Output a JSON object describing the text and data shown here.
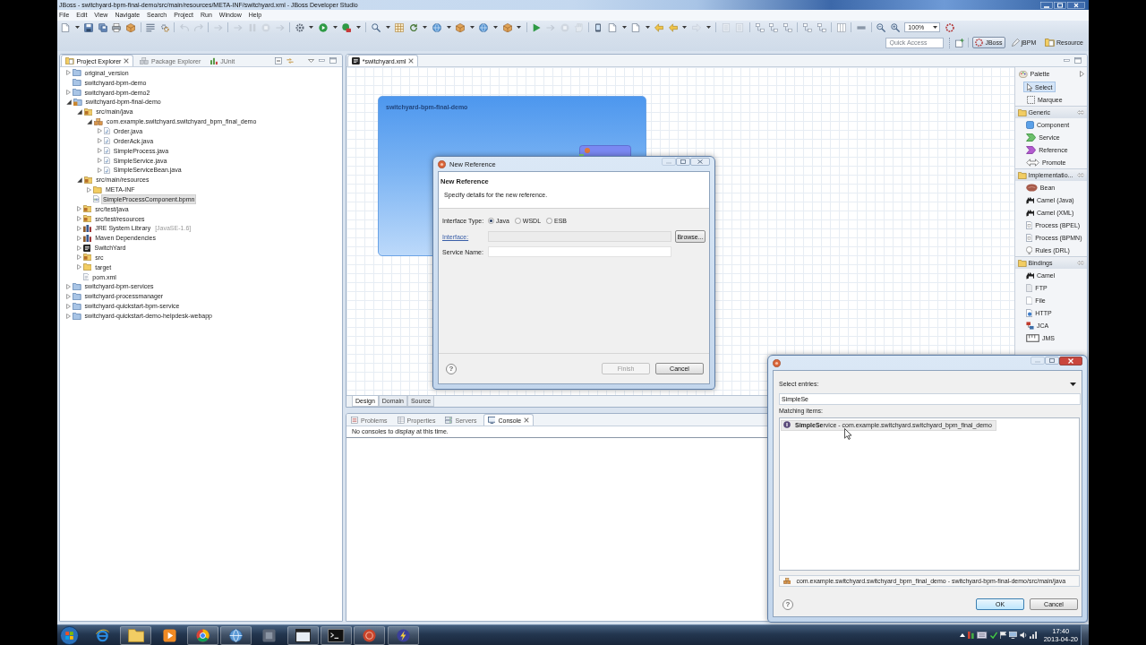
{
  "window": {
    "title": "JBoss - switchyard-bpm-final-demo/src/main/resources/META-INF/switchyard.xml - JBoss Developer Studio"
  },
  "menu": [
    "File",
    "Edit",
    "View",
    "Navigate",
    "Search",
    "Project",
    "Run",
    "Window",
    "Help"
  ],
  "toolbar": {
    "zoom": "100%"
  },
  "perspective_bar": {
    "quick_access": {
      "placeholder": "Quick Access"
    },
    "perspectives": [
      {
        "label": "JBoss",
        "kind": "jboss",
        "selected": true
      },
      {
        "label": "jBPM",
        "kind": "jbpm",
        "selected": false
      },
      {
        "label": "Resource",
        "kind": "resource",
        "selected": false
      }
    ]
  },
  "explorer": {
    "tabs": [
      {
        "label": "Project Explorer",
        "kind": "project",
        "selected": true
      },
      {
        "label": "Package Explorer",
        "kind": "package",
        "selected": false
      },
      {
        "label": "JUnit",
        "kind": "junit",
        "selected": false
      }
    ],
    "tree": [
      {
        "label": "original_version",
        "kind": "project",
        "expanded": false,
        "selected": false
      },
      {
        "label": "switchyard-bpm-demo",
        "kind": "project",
        "selected": false
      },
      {
        "label": "switchyard-bpm-demo2",
        "kind": "project",
        "expanded": false,
        "selected": false
      },
      {
        "label": "switchyard-bpm-final-demo",
        "kind": "java-project",
        "expanded": true,
        "selected": false,
        "children": [
          {
            "label": "src/main/java",
            "kind": "source-folder",
            "expanded": true,
            "selected": false,
            "children": [
              {
                "label": "com.example.switchyard.switchyard_bpm_final_demo",
                "kind": "package",
                "expanded": true,
                "selected": false,
                "children": [
                  {
                    "label": "Order.java",
                    "kind": "java-file",
                    "expanded": false,
                    "selected": false
                  },
                  {
                    "label": "OrderAck.java",
                    "kind": "java-file",
                    "expanded": false,
                    "selected": false
                  },
                  {
                    "label": "SimpleProcess.java",
                    "kind": "java-file",
                    "expanded": false,
                    "selected": false
                  },
                  {
                    "label": "SimpleService.java",
                    "kind": "java-file",
                    "expanded": false,
                    "selected": false
                  },
                  {
                    "label": "SimpleServiceBean.java",
                    "kind": "java-file",
                    "expanded": false,
                    "selected": false
                  }
                ]
              }
            ]
          },
          {
            "label": "src/main/resources",
            "kind": "source-folder",
            "expanded": true,
            "selected": false,
            "children": [
              {
                "label": "META-INF",
                "kind": "folder",
                "expanded": false,
                "selected": false
              },
              {
                "label": "SimpleProcessComponent.bpmn",
                "kind": "diagram-file",
                "selected": true
              }
            ]
          },
          {
            "label": "src/test/java",
            "kind": "source-folder",
            "expanded": false,
            "selected": false
          },
          {
            "label": "src/test/resources",
            "kind": "source-folder",
            "expanded": false,
            "selected": false
          },
          {
            "label": "JRE System Library",
            "decoration": "[JavaSE-1.6]",
            "kind": "library",
            "expanded": false,
            "selected": false
          },
          {
            "label": "Maven Dependencies",
            "kind": "library",
            "expanded": false,
            "selected": false
          },
          {
            "label": "SwitchYard",
            "kind": "switchyard",
            "expanded": false,
            "selected": false
          },
          {
            "label": "src",
            "kind": "source-folder",
            "expanded": false,
            "selected": false
          },
          {
            "label": "target",
            "kind": "folder",
            "expanded": false,
            "selected": false
          },
          {
            "label": "pom.xml",
            "kind": "xml-file",
            "selected": false
          }
        ]
      },
      {
        "label": "switchyard-bpm-services",
        "kind": "project",
        "expanded": false,
        "selected": false
      },
      {
        "label": "switchyard-processmanager",
        "kind": "project",
        "expanded": false,
        "selected": false
      },
      {
        "label": "switchyard-quickstart-bpm-service",
        "kind": "project",
        "expanded": false,
        "selected": false
      },
      {
        "label": "switchyard-quickstart-demo-helpdesk-webapp",
        "kind": "project",
        "expanded": false,
        "selected": false
      }
    ]
  },
  "editor": {
    "tab": "*switchyard.xml",
    "composite": "switchyard-bpm-final-demo",
    "pages": [
      {
        "label": "Design",
        "selected": true
      },
      {
        "label": "Domain",
        "selected": false
      },
      {
        "label": "Source",
        "selected": false
      }
    ]
  },
  "palette": {
    "title": "Palette",
    "tools": [
      {
        "label": "Select",
        "kind": "select",
        "selected": true
      },
      {
        "label": "Marquee",
        "kind": "marquee",
        "selected": false
      }
    ],
    "drawers": [
      {
        "label": "Generic",
        "items": [
          {
            "label": "Component",
            "kind": "component"
          },
          {
            "label": "Service",
            "kind": "service"
          },
          {
            "label": "Reference",
            "kind": "reference"
          },
          {
            "label": "Promote",
            "kind": "promote"
          }
        ]
      },
      {
        "label": "Implementatio...",
        "items": [
          {
            "label": "Bean",
            "kind": "bean"
          },
          {
            "label": "Camel (Java)",
            "kind": "camel"
          },
          {
            "label": "Camel (XML)",
            "kind": "camel"
          },
          {
            "label": "Process (BPEL)",
            "kind": "process"
          },
          {
            "label": "Process (BPMN)",
            "kind": "process"
          },
          {
            "label": "Rules (DRL)",
            "kind": "rules"
          }
        ]
      },
      {
        "label": "Bindings",
        "items": [
          {
            "label": "Camel",
            "kind": "camel"
          },
          {
            "label": "FTP",
            "kind": "ftp"
          },
          {
            "label": "File",
            "kind": "file"
          },
          {
            "label": "HTTP",
            "kind": "http"
          },
          {
            "label": "JCA",
            "kind": "jca"
          },
          {
            "label": "JMS",
            "kind": "jms"
          }
        ]
      }
    ]
  },
  "console": {
    "tabs": [
      {
        "label": "Problems",
        "kind": "problems",
        "selected": false
      },
      {
        "label": "Properties",
        "kind": "properties",
        "selected": false
      },
      {
        "label": "Servers",
        "kind": "servers",
        "selected": false
      },
      {
        "label": "Console",
        "kind": "console",
        "selected": true
      }
    ],
    "message": "No consoles to display at this time."
  },
  "new_reference_dialog": {
    "title": "New Reference",
    "heading": "New Reference",
    "description": "Specify details for the new reference.",
    "interface_type": {
      "label": "Interface Type:",
      "options": [
        {
          "label": "Java",
          "selected": true
        },
        {
          "label": "WSDL",
          "selected": false
        },
        {
          "label": "ESB",
          "selected": false
        }
      ]
    },
    "interface": {
      "label": "Interface:",
      "disabled": true
    },
    "browse_button": "Browse...",
    "service_name": {
      "label": "Service Name:"
    },
    "help_button": "?",
    "buttons": [
      {
        "label": "Finish",
        "disabled": true
      },
      {
        "label": "Cancel",
        "disabled": false
      }
    ]
  },
  "select_dialog": {
    "label": "Select entries:",
    "filter": {
      "value": "SimpleSe"
    },
    "matching_label": "Matching items:",
    "items": [
      {
        "text": "**SimpleSe**rvice - com.example.switchyard.switchyard_bpm_final_demo",
        "selected": true
      }
    ],
    "status": "com.example.switchyard.switchyard_bpm_final_demo - switchyard-bpm-final-demo/src/main/java",
    "help_button": "?",
    "buttons": [
      {
        "label": "OK",
        "default": true
      },
      {
        "label": "Cancel",
        "default": false
      }
    ]
  },
  "taskbar": {
    "apps": [
      {
        "kind": "browser",
        "running": false
      },
      {
        "kind": "folder",
        "running": true
      },
      {
        "kind": "player",
        "running": false
      },
      {
        "kind": "wheel",
        "running": true
      },
      {
        "kind": "globe",
        "running": true
      },
      {
        "kind": "tile",
        "running": false
      },
      {
        "kind": "window",
        "running": true
      },
      {
        "kind": "terminal",
        "running": true
      },
      {
        "kind": "ball",
        "running": true
      },
      {
        "kind": "bolt",
        "running": true
      }
    ],
    "clock": {
      "time": "17:40",
      "date": "2013-04-20"
    }
  }
}
